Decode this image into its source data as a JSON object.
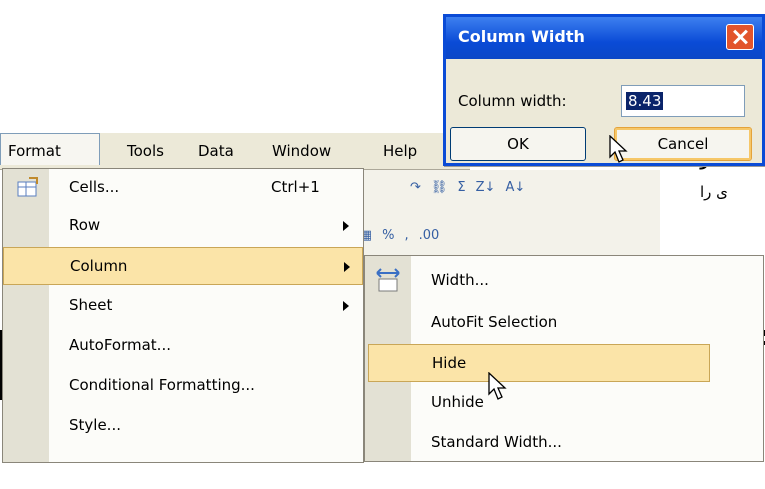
{
  "menubar": {
    "items": [
      {
        "label": "Format"
      },
      {
        "label": "Tools"
      },
      {
        "label": "Data"
      },
      {
        "label": "Window"
      },
      {
        "label": "Help"
      }
    ]
  },
  "format_menu": {
    "items": [
      {
        "label": "Cells...",
        "shortcut": "Ctrl+1"
      },
      {
        "label": "Row"
      },
      {
        "label": "Column"
      },
      {
        "label": "Sheet"
      },
      {
        "label": "AutoFormat..."
      },
      {
        "label": "Conditional Formatting..."
      },
      {
        "label": "Style..."
      }
    ]
  },
  "column_submenu": {
    "items": [
      {
        "label": "Width..."
      },
      {
        "label": "AutoFit Selection"
      },
      {
        "label": "Hide"
      },
      {
        "label": "Unhide"
      },
      {
        "label": "Standard Width..."
      }
    ]
  },
  "dialog": {
    "title": "Column Width",
    "field_label": "Column width:",
    "field_value": "8.43",
    "ok_label": "OK",
    "cancel_label": "Cancel"
  },
  "toolbar": {
    "percent": "%",
    "comma": ","
  },
  "background_text": {
    "line1": "گ:در",
    "line2": "ی را"
  },
  "colors": {
    "highlight": "#fbe4a8",
    "titlebar": "#0a4bd6",
    "menu_bg": "#fcfcf9"
  }
}
